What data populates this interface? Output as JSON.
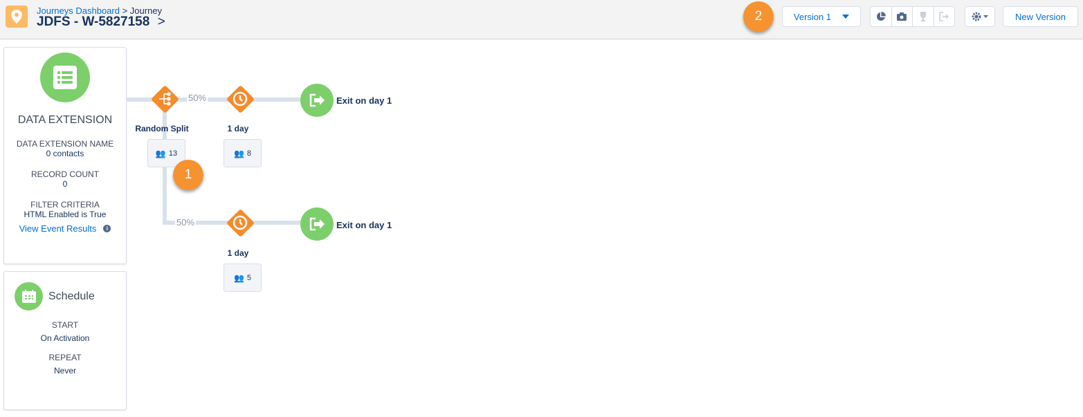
{
  "header": {
    "breadcrumb_link": "Journeys Dashboard",
    "breadcrumb_sep": " > ",
    "breadcrumb_current": "Journey",
    "title": "JDFS - W-5827158",
    "title_chevron": ">",
    "version_label": "Version 1",
    "new_version_label": "New Version",
    "step_badge": "2"
  },
  "toolbar_icons": [
    "pie-chart-icon",
    "camera-icon",
    "trophy-icon",
    "exit-icon",
    "gear-icon"
  ],
  "entry": {
    "title": "DATA EXTENSION",
    "fields": [
      {
        "label": "DATA EXTENSION NAME",
        "value": "0 contacts"
      },
      {
        "label": "RECORD COUNT",
        "value": "0"
      },
      {
        "label": "FILTER CRITERIA",
        "value": "HTML Enabled is True"
      }
    ],
    "link": "View Event Results"
  },
  "schedule": {
    "title": "Schedule",
    "fields": [
      {
        "label": "START",
        "value": "On Activation"
      },
      {
        "label": "REPEAT",
        "value": "Never"
      }
    ]
  },
  "canvas": {
    "split": {
      "label": "Random Split",
      "count": "13"
    },
    "top": {
      "percent": "50%",
      "wait_label": "1 day",
      "wait_count": "8",
      "exit_label": "Exit on day 1"
    },
    "bottom": {
      "percent": "50%",
      "wait_label": "1 day",
      "wait_count": "5",
      "exit_label": "Exit on day 1"
    },
    "step_badge": "1"
  },
  "colors": {
    "accent_orange": "#f58b2a",
    "green": "#7ccf6b",
    "link_blue": "#0070d2"
  }
}
